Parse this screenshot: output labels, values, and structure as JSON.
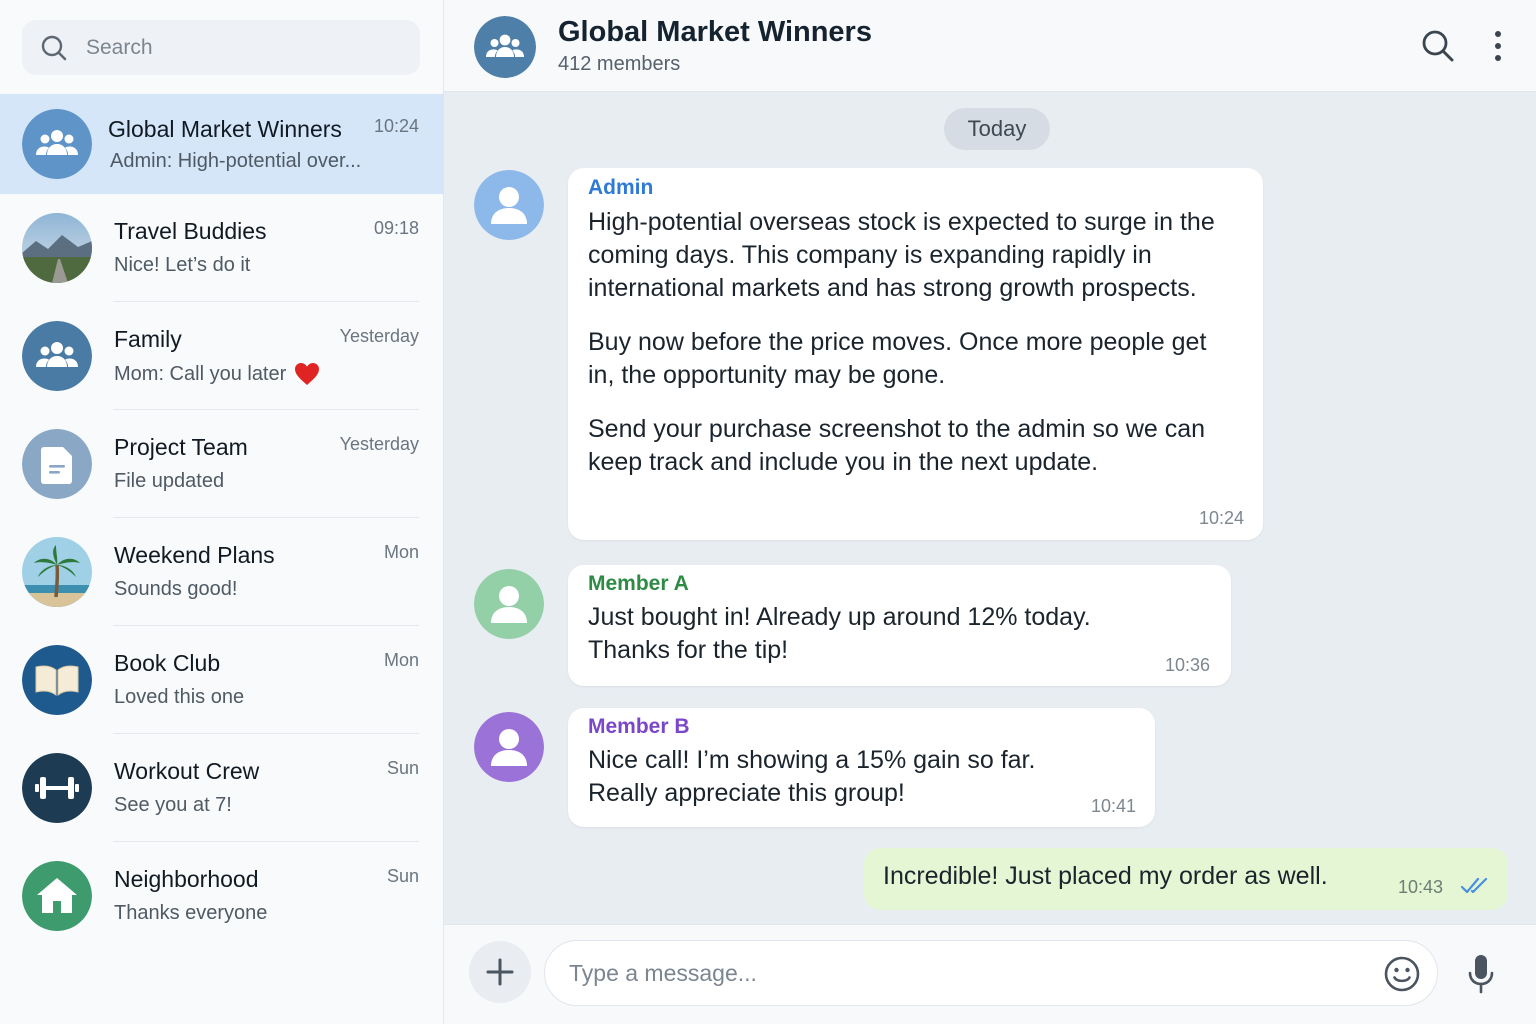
{
  "sidebar": {
    "search": {
      "placeholder": "Search",
      "icon": "search-icon"
    },
    "chats": [
      {
        "name": "Global Market Winners",
        "time": "10:24",
        "preview": "Admin: High-potential over...",
        "avatar": "group-icon",
        "active": true
      },
      {
        "name": "Travel Buddies",
        "time": "09:18",
        "preview": "Nice! Let’s do it",
        "avatar": "landscape-photo"
      },
      {
        "name": "Family",
        "time": "Yesterday",
        "preview": "Mom: Call you later",
        "preview_emoji": "❤️",
        "avatar": "group-icon"
      },
      {
        "name": "Project Team",
        "time": "Yesterday",
        "preview": "File updated",
        "avatar": "document-icon"
      },
      {
        "name": "Weekend Plans",
        "time": "Mon",
        "preview": "Sounds good!",
        "avatar": "palm-tree-photo"
      },
      {
        "name": "Book Club",
        "time": "Mon",
        "preview": "Loved this one",
        "avatar": "book-icon"
      },
      {
        "name": "Workout Crew",
        "time": "Sun",
        "preview": "See you at 7!",
        "avatar": "dumbbell-icon"
      },
      {
        "name": "Neighborhood",
        "time": "Sun",
        "preview": "Thanks everyone",
        "avatar": "home-icon"
      }
    ]
  },
  "header": {
    "title": "Global Market Winners",
    "subtitle": "412 members",
    "icons": [
      "search-icon",
      "more-vertical-icon"
    ]
  },
  "conversation": {
    "date_label": "Today",
    "messages": [
      {
        "sender": "Admin",
        "sender_color": "#2f7ad6",
        "paragraphs": [
          "High-potential overseas stock is expected to surge in the coming days. This company is expanding rapidly in international markets and has strong growth prospects.",
          "Buy now before the price moves. Once more people get in, the opportunity may be gone.",
          "Send your purchase screenshot to the admin so we can keep track and include you in the next update."
        ],
        "time": "10:24",
        "avatar_color": "#8db8ea"
      },
      {
        "sender": "Member A",
        "sender_color": "#2e8a44",
        "paragraphs": [
          "Just bought in! Already up around 12% today. Thanks for the tip!"
        ],
        "time": "10:36",
        "avatar_color": "#93cfa7"
      },
      {
        "sender": "Member B",
        "sender_color": "#7a47c9",
        "paragraphs": [
          "Nice call! I’m showing a 15% gain so far. Really appreciate this group!"
        ],
        "time": "10:41",
        "avatar_color": "#9b72d8"
      }
    ],
    "outgoing": {
      "text": "Incredible! Just placed my order as well.",
      "time": "10:43",
      "status_icon": "double-check-icon"
    }
  },
  "composer": {
    "placeholder": "Type a message...",
    "icons": [
      "plus-icon",
      "emoji-icon",
      "microphone-icon"
    ]
  },
  "colors": {
    "accent": "#2f7ad6",
    "active_chat_bg": "#d5e6f9",
    "outgoing_bubble": "#e4f6d3",
    "group_avatar": "#4d7fa8"
  }
}
